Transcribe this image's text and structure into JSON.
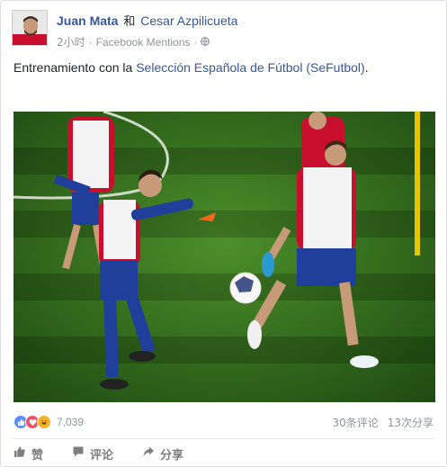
{
  "post": {
    "author": "Juan Mata",
    "conjunction": "和",
    "tagged": "Cesar Azpilicueta",
    "time": "2小时",
    "separator": "·",
    "source": "Facebook Mentions",
    "audience_icon": "globe-icon",
    "caption_prefix": "Entrenamiento con la ",
    "caption_link": "Selección Española de Fútbol (SeFutbol)",
    "caption_suffix": "."
  },
  "stats": {
    "reaction_icons": [
      "like-icon",
      "love-icon",
      "haha-icon"
    ],
    "reaction_count": "7,039",
    "comments": "30条评论",
    "shares": "13次分享"
  },
  "actions": [
    {
      "label": "赞",
      "icon": "thumbs-up-icon"
    },
    {
      "label": "评论",
      "icon": "comment-icon"
    },
    {
      "label": "分享",
      "icon": "share-icon"
    }
  ],
  "colors": {
    "link": "#365899",
    "muted": "#90949c",
    "like": "#5890ff",
    "love": "#f25268",
    "haha": "#f7b125",
    "pitch": "#2f6b1c",
    "jersey_red": "#c8102e",
    "shorts_blue": "#1f3f9a"
  }
}
